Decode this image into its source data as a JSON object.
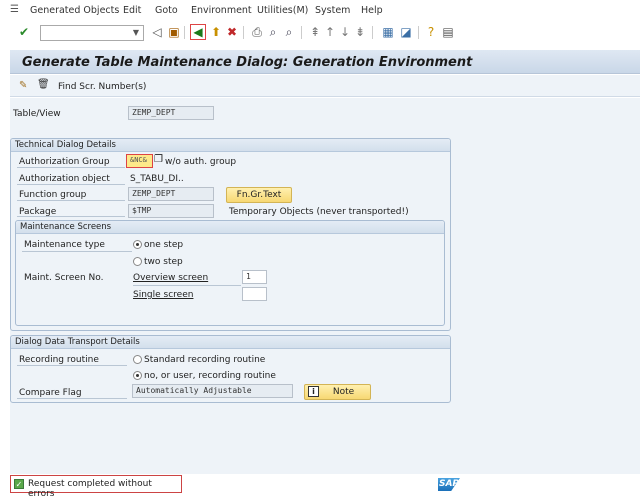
{
  "menu": [
    "Generated Objects",
    "Edit",
    "Goto",
    "Environment",
    "Utilities(M)",
    "System",
    "Help"
  ],
  "title": "Generate Table Maintenance Dialog: Generation Environment",
  "app_toolbar": {
    "find_label": "Find Scr. Number(s)"
  },
  "table_view": {
    "label": "Table/View",
    "value": "ZEMP_DEPT"
  },
  "technical": {
    "title": "Technical Dialog Details",
    "auth_group_label": "Authorization Group",
    "auth_group_value": "&NC&",
    "auth_group_desc": "w/o auth. group",
    "auth_object_label": "Authorization object",
    "auth_object_value": "S_TABU_DI..",
    "function_group_label": "Function group",
    "function_group_value": "ZEMP_DEPT",
    "fn_text_button": "Fn.Gr.Text",
    "package_label": "Package",
    "package_value": "$TMP",
    "package_desc": "Temporary Objects (never transported!)"
  },
  "maint": {
    "title": "Maintenance Screens",
    "type_label": "Maintenance type",
    "one_step": "one step",
    "two_step": "two step",
    "selected": "one step",
    "screen_no_label": "Maint. Screen No.",
    "overview_label": "Overview screen",
    "overview_value": "1",
    "single_label": "Single screen",
    "single_value": ""
  },
  "transport": {
    "title": "Dialog Data Transport Details",
    "recording_label": "Recording routine",
    "standard": "Standard recording routine",
    "no_user": "no, or user, recording routine",
    "selected": "no, or user, recording routine",
    "compare_label": "Compare Flag",
    "compare_value": "Automatically Adjustable",
    "note_button": "Note"
  },
  "status": {
    "message": "Request completed without errors",
    "logo": "SAP"
  }
}
